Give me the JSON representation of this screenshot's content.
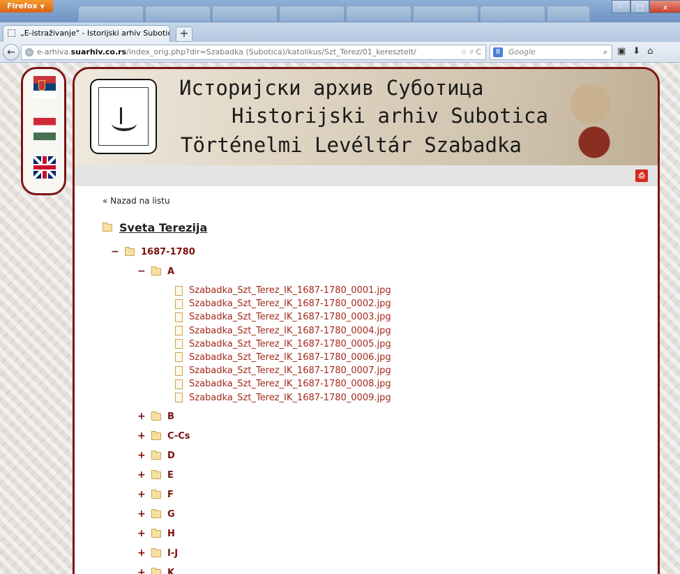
{
  "browser": {
    "app_button": "Firefox",
    "tab_title": "„E-istraživanje\" - Istorijski arhiv Subotica",
    "new_tab": "+",
    "url_prefix": "e-arhiva.",
    "url_domain": "suarhiv.co.rs",
    "url_path": "/index_orig.php?dir=Szabadka (Subotica)/katolikus/Szt_Terez/01_kereszteIt/",
    "search_engine": "8",
    "search_placeholder": "Google",
    "window_controls": [
      "–",
      "□",
      "x"
    ]
  },
  "header": {
    "title_cyrillic": "Историјски архив Суботица",
    "title_latin": "Historijski arhiv Subotica",
    "title_hungarian": "Történelmi Levéltár Szabadka"
  },
  "languages": [
    "serbian-flag",
    "hungarian-flag",
    "english-flag"
  ],
  "content": {
    "back_link": "« Nazad na listu",
    "root_folder": "Sveta Terezija",
    "year_folder": {
      "toggle": "−",
      "label": "1687-1780"
    },
    "open_folder": {
      "toggle": "−",
      "label": "A"
    },
    "files": [
      "Szabadka_Szt_Terez_IK_1687-1780_0001.jpg",
      "Szabadka_Szt_Terez_IK_1687-1780_0002.jpg",
      "Szabadka_Szt_Terez_IK_1687-1780_0003.jpg",
      "Szabadka_Szt_Terez_IK_1687-1780_0004.jpg",
      "Szabadka_Szt_Terez_IK_1687-1780_0005.jpg",
      "Szabadka_Szt_Terez_IK_1687-1780_0006.jpg",
      "Szabadka_Szt_Terez_IK_1687-1780_0007.jpg",
      "Szabadka_Szt_Terez_IK_1687-1780_0008.jpg",
      "Szabadka_Szt_Terez_IK_1687-1780_0009.jpg"
    ],
    "closed_folders": [
      {
        "toggle": "+",
        "label": "B"
      },
      {
        "toggle": "+",
        "label": "C-Cs"
      },
      {
        "toggle": "+",
        "label": "D"
      },
      {
        "toggle": "+",
        "label": "E"
      },
      {
        "toggle": "+",
        "label": "F"
      },
      {
        "toggle": "+",
        "label": "G"
      },
      {
        "toggle": "+",
        "label": "H"
      },
      {
        "toggle": "+",
        "label": "I-J"
      },
      {
        "toggle": "+",
        "label": "K"
      }
    ]
  },
  "colors": {
    "frame": "#7c1414",
    "folder_text": "#7a1010",
    "file_text": "#a3281a"
  }
}
